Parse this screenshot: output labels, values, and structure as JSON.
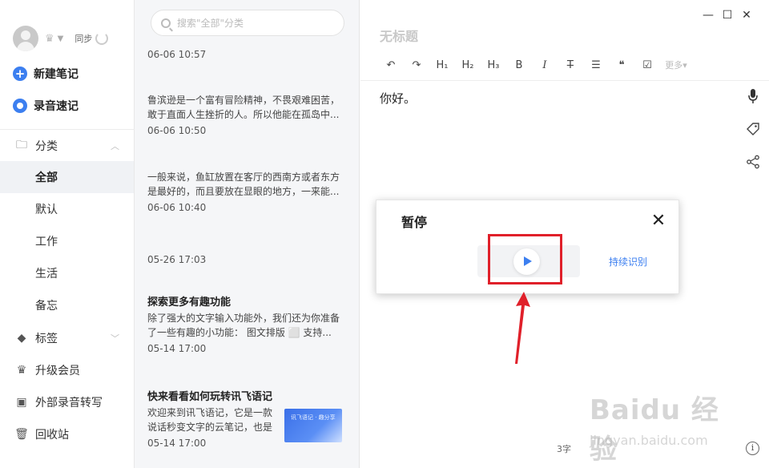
{
  "sidebar": {
    "sync_label": "同步",
    "new_note": "新建笔记",
    "voice_note": "录音速记",
    "nav": [
      {
        "label": "分类",
        "icon": "folder-icon"
      },
      {
        "label": "全部"
      },
      {
        "label": "默认"
      },
      {
        "label": "工作"
      },
      {
        "label": "生活"
      },
      {
        "label": "备忘"
      },
      {
        "label": "标签",
        "icon": "tag-icon"
      },
      {
        "label": "升级会员",
        "icon": "crown-icon"
      },
      {
        "label": "外部录音转写",
        "icon": "recorder-icon"
      },
      {
        "label": "回收站",
        "icon": "trash-icon"
      }
    ]
  },
  "list": {
    "search_placeholder": "搜索\"全部\"分类",
    "notes": [
      {
        "title": "",
        "body": "",
        "date": "06-06 10:57"
      },
      {
        "title": "",
        "body": "鲁滨逊是一个富有冒险精神，不畏艰难困苦，敢于直面人生挫折的人。所以他能在孤岛中...",
        "date": "06-06 10:50"
      },
      {
        "title": "",
        "body": "一般来说，鱼缸放置在客厅的西南方或者东方是最好的，而且要放在显眼的地方，一来能...",
        "date": "06-06 10:40"
      },
      {
        "title": "",
        "body": "",
        "date": "05-26 17:03"
      },
      {
        "title": "探索更多有趣功能",
        "body": "除了强大的文字输入功能外，我们还为你准备了一些有趣的小功能：   图文排版 ⬜ 支持...",
        "date": "05-14 17:00"
      },
      {
        "title": "快来看看如何玩转讯飞语记",
        "body": "欢迎来到讯飞语记，它是一款说话秒变文字的云笔记，也是一...",
        "date": "05-14 17:00"
      }
    ],
    "thumbnail_text": "讯飞语记 · 趣分享"
  },
  "editor": {
    "title_placeholder": "无标题",
    "toolbar": [
      "↶",
      "↷",
      "H₁",
      "H₂",
      "H₃",
      "B",
      "I",
      "T̶",
      "☰",
      "❝",
      "☑"
    ],
    "more_label": "更多▾",
    "content": "你好。",
    "word_count": "3字",
    "window_controls": [
      "—",
      "☐",
      "✕"
    ]
  },
  "popup": {
    "title": "暂停",
    "continuous_label": "持续识别"
  },
  "watermark": {
    "main": "Baidu 经验",
    "sub": "jingyan.baidu.com"
  },
  "colors": {
    "accent": "#3c7ff0",
    "annotation": "#e0202a"
  }
}
